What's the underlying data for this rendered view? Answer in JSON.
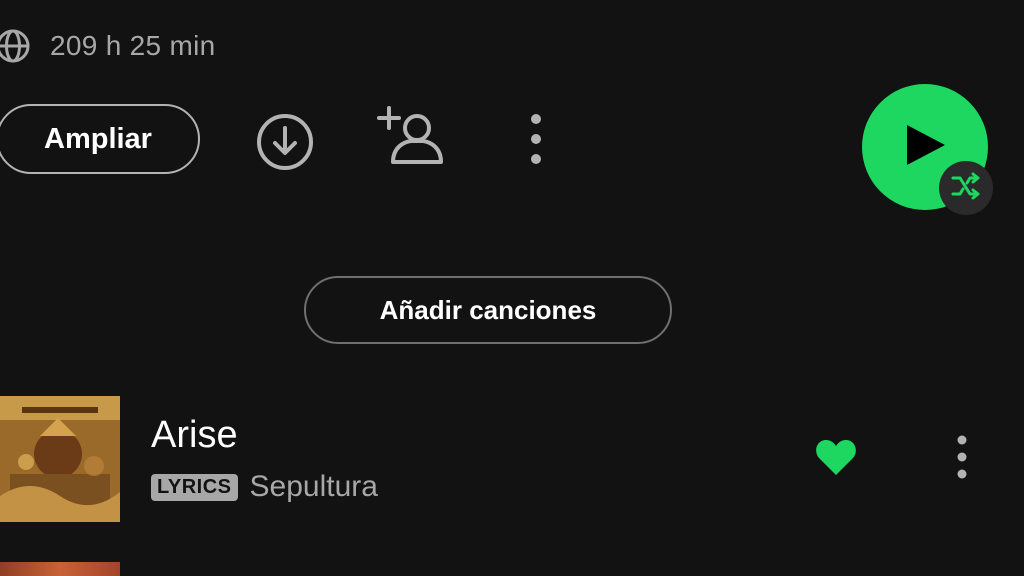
{
  "header": {
    "duration": "209 h 25 min",
    "globe_icon": "globe-icon"
  },
  "actions": {
    "expand_label": "Ampliar",
    "download_icon": "download-icon",
    "add_user_icon": "add-user-icon",
    "more_icon": "more-vertical-icon",
    "play_icon": "play-icon",
    "shuffle_icon": "shuffle-icon"
  },
  "add_songs": {
    "label": "Añadir canciones"
  },
  "tracks": [
    {
      "title": "Arise",
      "badge": "LYRICS",
      "artist": "Sepultura",
      "liked": true
    }
  ],
  "colors": {
    "background": "#121212",
    "accent": "#1ed760",
    "secondary_text": "#a7a7a7",
    "text": "#ffffff"
  }
}
